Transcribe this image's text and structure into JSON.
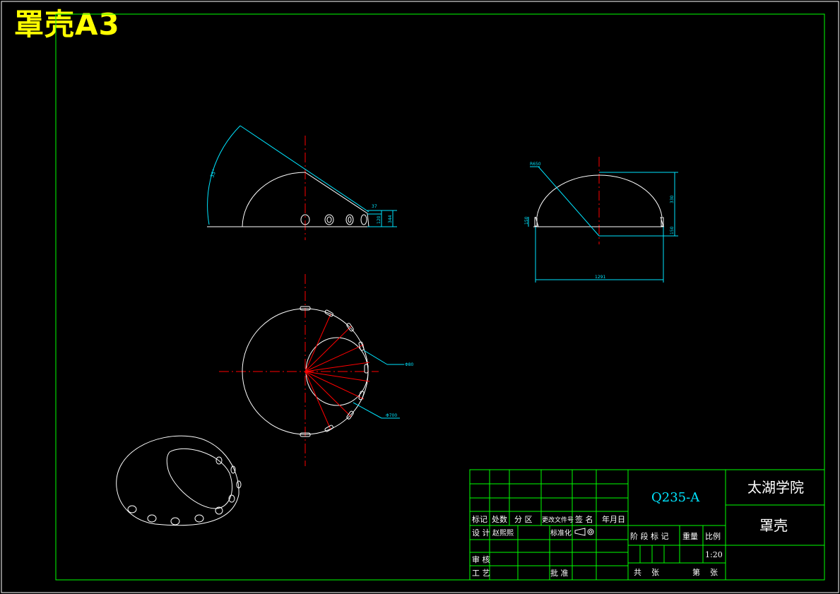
{
  "drawing": {
    "title": "罩壳A3",
    "material": "Q235-A",
    "institution": "太湖学院",
    "part_name": "罩壳",
    "scale": "1:20"
  },
  "title_block": {
    "revision_headers": [
      "标记",
      "处数",
      "分 区",
      "更改文件号",
      "签 名",
      "年月日"
    ],
    "design_label": "设 计",
    "designer": "赵熙熙",
    "standardization_label": "标准化",
    "stage_mark_label": "阶 段 标 记",
    "weight_label": "重量",
    "scale_label": "比例",
    "review_label": "审 核",
    "process_label": "工 艺",
    "approve_label": "批 准",
    "total_sheets_label": "共    张",
    "sheet_no_label": "第    张"
  },
  "dimensions": {
    "angle": "35°",
    "d1": "37",
    "d2": "120",
    "d3": "344",
    "radius": "R650",
    "height": "330",
    "side_left": "150",
    "side_right": "150",
    "width": "1291",
    "hole_label": "Φ80",
    "opening_diameter": "Φ700"
  },
  "colors": {
    "frame": "#00ff00",
    "outline": "#ffffff",
    "center_line": "#ff0000",
    "dimension": "#00e5ff",
    "title": "#ffff00"
  }
}
